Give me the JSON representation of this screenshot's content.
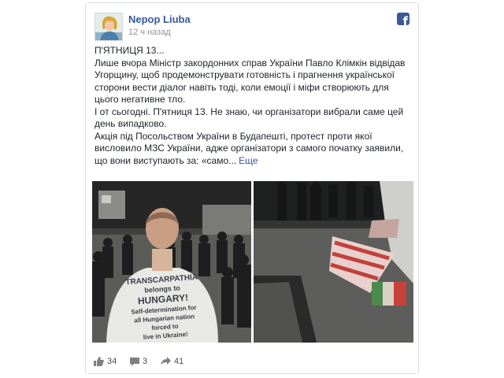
{
  "post": {
    "author": "Nepop Liuba",
    "time": "12 ч назад",
    "paragraphs": [
      "П'ЯТНИЦЯ 13...",
      "Лише вчора Міністр закордонних справ України Павло Клімкін відвідав Угорщину, щоб продемонструвати готовність і прагнення української сторони вести діалог навіть тоді, коли емоції і міфи створюють для цього негативне тло.",
      "І от сьогодні. П'ятниця 13. Не знаю, чи організатори вибрали саме цей день випадково.",
      "Акція під Посольством України в Будапешті, протест проти якої висловило МЗС України, адже організатори з самого початку заявили, що вони виступають за: «само..."
    ],
    "more_label": "Еще",
    "shirt_text": [
      "TRANSCARPATHIA",
      "belongs to",
      "HUNGARY!",
      "Self-determination for",
      "all Hungarian nation",
      "forced to",
      "live in Ukraine!"
    ]
  },
  "footer": {
    "likes": "34",
    "comments": "3",
    "shares": "41"
  },
  "colors": {
    "link": "#365899",
    "facebook_blue": "#3b5998",
    "text": "#1d2129",
    "muted": "#90949c"
  },
  "icons": {
    "header": "facebook-icon",
    "likes": "thumbs-up-icon",
    "comments": "comment-icon",
    "shares": "share-arrow-icon"
  }
}
